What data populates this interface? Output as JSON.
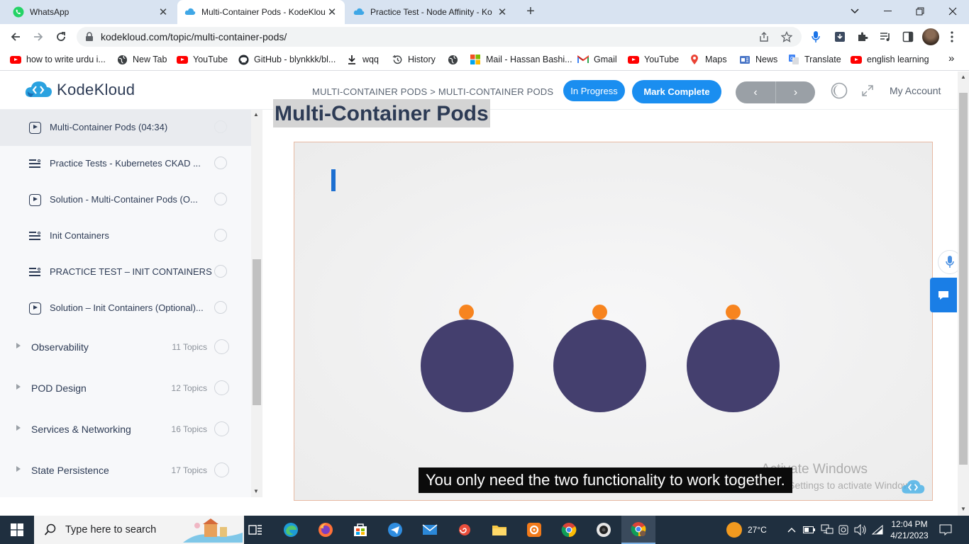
{
  "browser": {
    "tabs": [
      {
        "title": "WhatsApp",
        "active": false
      },
      {
        "title": "Multi-Container Pods - KodeKlou",
        "active": true
      },
      {
        "title": "Practice Test - Node Affinity - Ko",
        "active": false
      }
    ],
    "new_tab_symbol": "+",
    "url": "kodekloud.com/topic/multi-container-pods/",
    "bookmarks": [
      {
        "label": "how to write urdu i...",
        "icon": "youtube-icon"
      },
      {
        "label": "New Tab",
        "icon": "globe-icon"
      },
      {
        "label": "YouTube",
        "icon": "youtube-icon"
      },
      {
        "label": "GitHub - blynkkk/bl...",
        "icon": "github-icon"
      },
      {
        "label": "wqq",
        "icon": "download-icon"
      },
      {
        "label": "History",
        "icon": "history-icon"
      },
      {
        "label": "",
        "icon": "globe-icon"
      },
      {
        "label": "Mail - Hassan Bashi...",
        "icon": "microsoft-icon"
      },
      {
        "label": "Gmail",
        "icon": "gmail-icon"
      },
      {
        "label": "YouTube",
        "icon": "youtube-icon"
      },
      {
        "label": "Maps",
        "icon": "maps-icon"
      },
      {
        "label": "News",
        "icon": "news-icon"
      },
      {
        "label": "Translate",
        "icon": "translate-icon"
      },
      {
        "label": "english learning",
        "icon": "youtube-icon"
      }
    ],
    "bookmarks_overflow": "»"
  },
  "header": {
    "brand": "KodeKloud",
    "breadcrumb": "MULTI-CONTAINER PODS > MULTI-CONTAINER PODS",
    "status_badge": "In Progress",
    "mark_complete": "Mark Complete",
    "prev_symbol": "‹",
    "next_symbol": "›",
    "account": "My Account"
  },
  "sidebar": {
    "lessons": [
      {
        "title": "Multi-Container Pods (04:34)",
        "type": "video",
        "active": true
      },
      {
        "title": "Practice Tests - Kubernetes CKAD ...",
        "type": "quiz",
        "active": false
      },
      {
        "title": "Solution - Multi-Container Pods (O...",
        "type": "video",
        "active": false
      },
      {
        "title": "Init Containers",
        "type": "quiz",
        "active": false
      },
      {
        "title": "PRACTICE TEST – INIT CONTAINERS",
        "type": "quiz",
        "active": false
      },
      {
        "title": "Solution – Init Containers (Optional)...",
        "type": "video",
        "active": false
      }
    ],
    "modules": [
      {
        "title": "Observability",
        "count": "11 Topics"
      },
      {
        "title": "POD Design",
        "count": "12 Topics"
      },
      {
        "title": "Services & Networking",
        "count": "16 Topics"
      },
      {
        "title": "State Persistence",
        "count": "17 Topics"
      }
    ]
  },
  "content": {
    "page_title": "Multi-Container Pods",
    "caption": "You only need the two functionality to work together.",
    "watermark_line1": "Activate Windows",
    "watermark_line2": "Go to Settings to activate Windows."
  },
  "taskbar": {
    "search_placeholder": "Type here to search",
    "weather": "27°C",
    "time": "12:04 PM",
    "date": "4/21/2023"
  },
  "colors": {
    "accent_blue": "#1a8ef0",
    "pod_fill": "#443f6e",
    "pod_dot": "#f7841f",
    "brand_text": "#2d3b55"
  }
}
